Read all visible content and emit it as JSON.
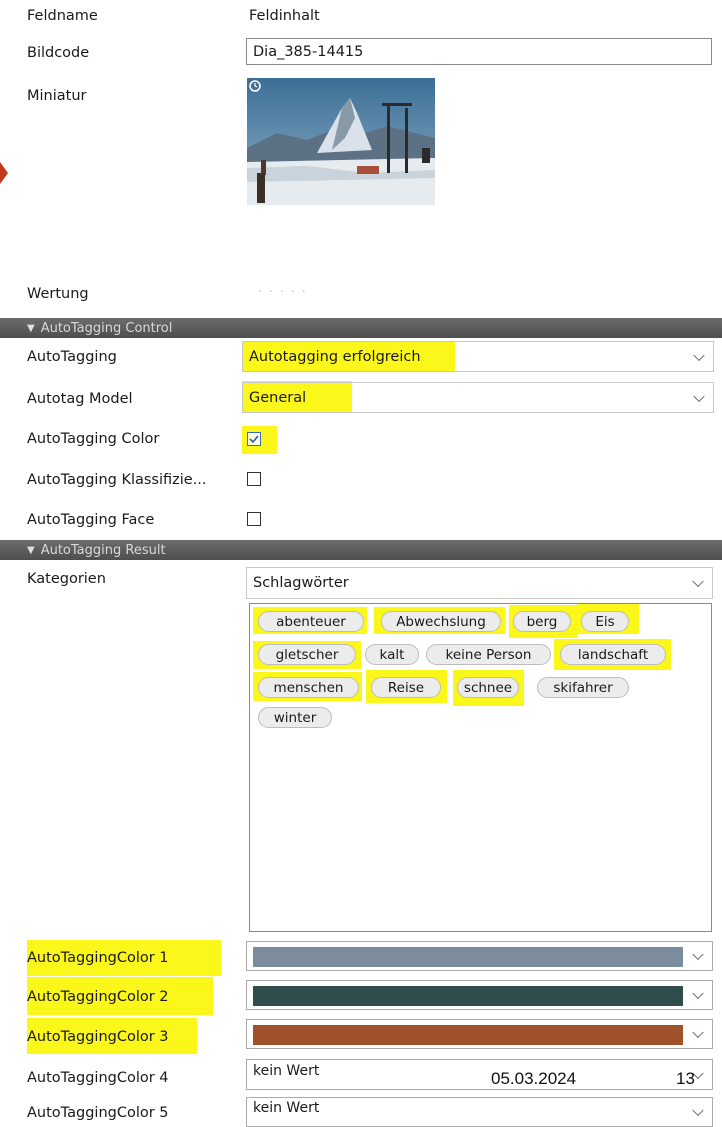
{
  "header": {
    "col_name": "Feldname",
    "col_value": "Feldinhalt"
  },
  "fields": {
    "bildcode_label": "Bildcode",
    "bildcode_value": "Dia_385-14415",
    "miniatur_label": "Miniatur",
    "wertung_label": "Wertung",
    "wertung_dots": "· · · · ·"
  },
  "section_control": {
    "title": "AutoTagging Control"
  },
  "control": {
    "autotagging_label": "AutoTagging",
    "autotagging_value": "Autotagging erfolgreich",
    "model_label": "Autotag Model",
    "model_value": "General",
    "color_label": "AutoTagging Color",
    "color_checked": true,
    "klass_label": "AutoTagging Klassifizie...",
    "klass_checked": false,
    "face_label": "AutoTagging Face",
    "face_checked": false
  },
  "section_result": {
    "title": "AutoTagging Result"
  },
  "result": {
    "kategorien_label": "Kategorien",
    "kategorien_value": "Schlagwörter",
    "tags": [
      "abenteuer",
      "Abwechslung",
      "berg",
      "Eis",
      "gletscher",
      "kalt",
      "keine Person",
      "landschaft",
      "menschen",
      "Reise",
      "schnee",
      "skifahrer",
      "winter"
    ],
    "tags_highlighted": [
      "abenteuer",
      "Abwechslung",
      "berg",
      "Eis",
      "gletscher",
      "landschaft",
      "menschen",
      "Reise",
      "schnee"
    ]
  },
  "colors": [
    {
      "label": "AutoTaggingColor 1",
      "swatch": "#7b8c9c"
    },
    {
      "label": "AutoTaggingColor 2",
      "swatch": "#2f4d4a"
    },
    {
      "label": "AutoTaggingColor 3",
      "swatch": "#a0522d"
    },
    {
      "label": "AutoTaggingColor 4",
      "value": "kein Wert"
    },
    {
      "label": "AutoTaggingColor 5",
      "value": "kein Wert"
    }
  ],
  "footer": {
    "date": "05.03.2024",
    "page": "13"
  },
  "accent": {
    "highlight": "#fbf71a",
    "section_bar": "#5a5a5a"
  }
}
